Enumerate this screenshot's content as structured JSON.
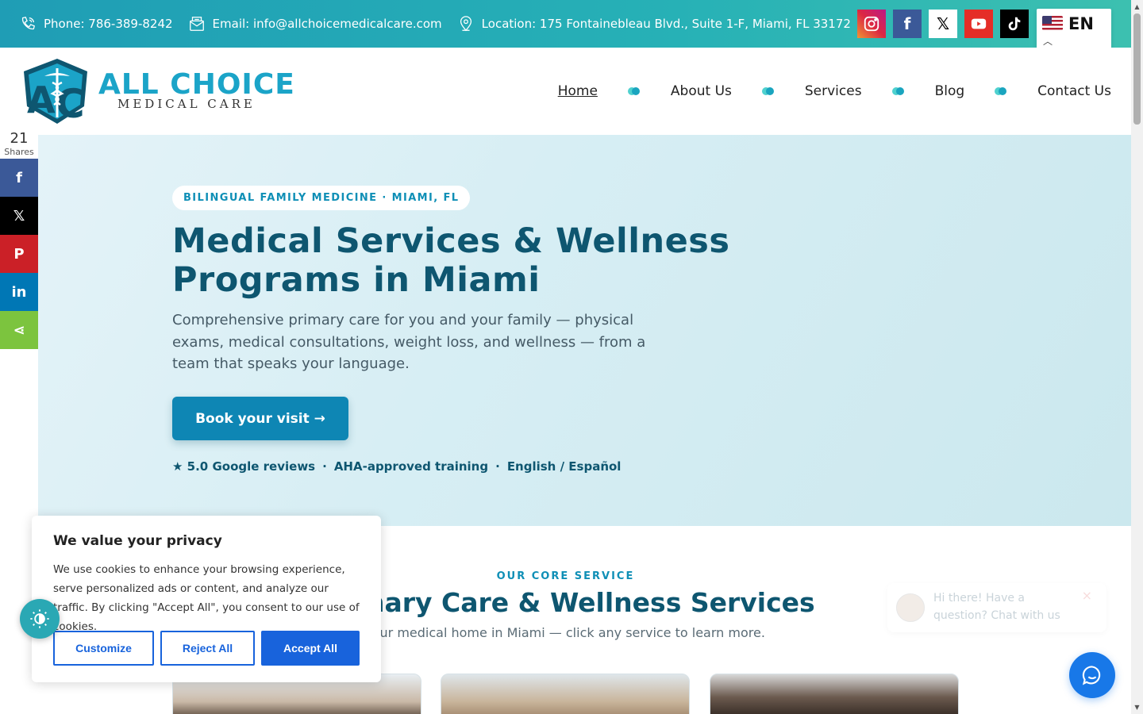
{
  "topbar": {
    "phone": "Phone: 786-389-8242",
    "email": "Email: info@allchoicemedicalcare.com",
    "location": "Location: 175 Fontainebleau Blvd., Suite 1-F, Miami, FL 33172",
    "socials": [
      "instagram-icon",
      "facebook-icon",
      "x-icon",
      "youtube-icon",
      "tiktok-icon"
    ],
    "language": "EN"
  },
  "logo": {
    "line1": "ALL CHOICE",
    "line2": "MEDICAL CARE"
  },
  "nav": {
    "items": [
      "Home",
      "About Us",
      "Services",
      "Blog",
      "Contact Us"
    ],
    "active": "Home"
  },
  "share": {
    "count": "21",
    "label": "Shares",
    "buttons": [
      {
        "name": "facebook",
        "glyph": "f",
        "color": "#3b5998"
      },
      {
        "name": "x",
        "glyph": "𝕏",
        "color": "#000000"
      },
      {
        "name": "pinterest",
        "glyph": "P",
        "color": "#cb2027"
      },
      {
        "name": "linkedin",
        "glyph": "in",
        "color": "#0077b5"
      },
      {
        "name": "sharethis",
        "glyph": "⋖",
        "color": "#7cc43e"
      }
    ]
  },
  "hero": {
    "badge": "BILINGUAL FAMILY MEDICINE · MIAMI, FL",
    "title": "Medical Services & Wellness Programs in Miami",
    "subtitle": "Comprehensive primary care for you and your family — physical exams, medical consultations, weight loss, and wellness — from a team that speaks your language.",
    "cta": "Book your visit →",
    "trust": [
      "★ 5.0 Google reviews",
      "AHA-approved training",
      "English / Español"
    ],
    "trust_separator": "·"
  },
  "core": {
    "eyebrow": "OUR CORE SERVICE",
    "title": "Primary Care & Wellness Services",
    "subtitle": "Your medical home in Miami — click any service to learn more."
  },
  "cookie": {
    "title": "We value your privacy",
    "body": "We use cookies to enhance your browsing experience, serve personalized ads or content, and analyze our traffic. By clicking \"Accept All\", you consent to our use of cookies.",
    "customize": "Customize",
    "reject": "Reject All",
    "accept": "Accept All"
  },
  "chat": {
    "greeting": "Hi there! Have a question? Chat with us",
    "close": "×"
  },
  "colors": {
    "accent": "#0e86b4",
    "heading": "#0e5670",
    "cookie_blue": "#1863dc",
    "chat_blue": "#1878e8"
  }
}
